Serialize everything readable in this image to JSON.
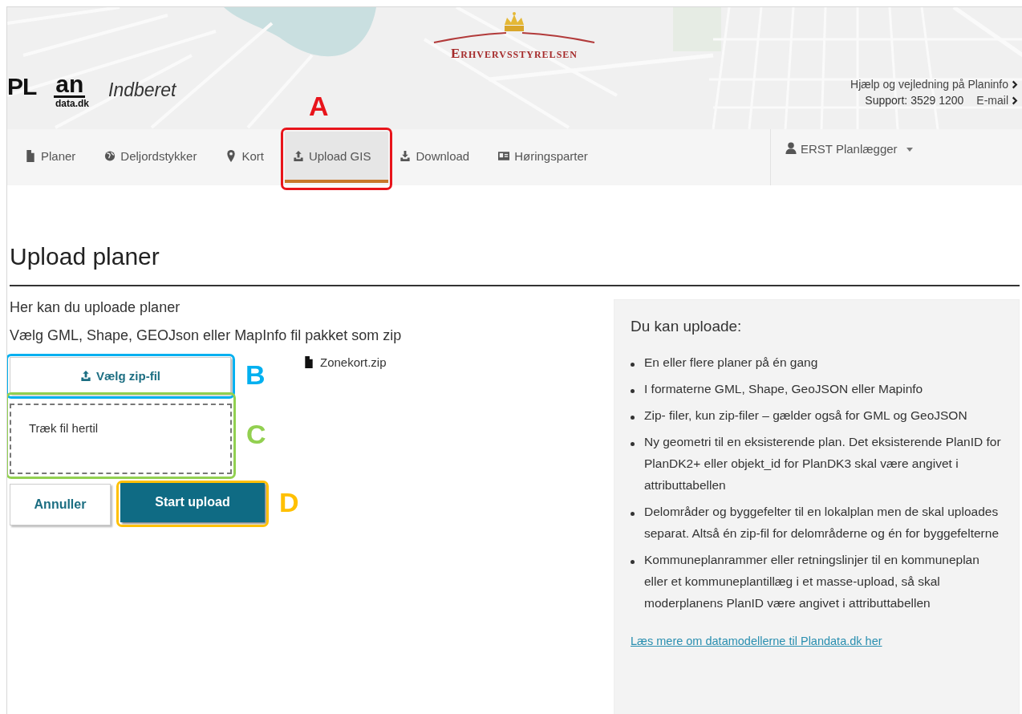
{
  "header": {
    "agency": "Erhvervsstyrelsen",
    "logo_top": "PL",
    "logo_right": "an",
    "logo_sub": "data.dk",
    "app_name": "Indberet",
    "help_link": "Hjælp og vejledning på Planinfo",
    "support": "Support: 3529 1200",
    "email_link": "E-mail"
  },
  "nav": {
    "items": [
      {
        "label": "Planer",
        "selected": false
      },
      {
        "label": "Deljordstykker",
        "selected": false
      },
      {
        "label": "Kort",
        "selected": false
      },
      {
        "label": "Upload GIS",
        "selected": true,
        "callout": {
          "label": "A",
          "color": "#e8141b"
        }
      },
      {
        "label": "Download",
        "selected": false
      },
      {
        "label": "Høringsparter",
        "selected": false
      }
    ],
    "user": "ERST Planlægger"
  },
  "page_title": "Upload planer",
  "intro": [
    "Her kan du uploade planer",
    "Vælg GML, Shape, GEOJson eller MapInfo fil pakket som zip"
  ],
  "choose_button": {
    "label": "Vælg zip-fil",
    "callout": {
      "label": "B",
      "color": "#00b0f0"
    }
  },
  "selected_file": "Zonekort.zip",
  "drop_zone": {
    "text": "Træk fil hertil",
    "callout": {
      "label": "C",
      "color": "#92d050"
    }
  },
  "cancel_button": "Annuller",
  "start_button": {
    "label": "Start upload",
    "callout": {
      "label": "D",
      "color": "#ffc000"
    }
  },
  "info_panel": {
    "title": "Du kan uploade:",
    "items": [
      "En eller flere planer på én gang",
      "I formaterne GML, Shape, GeoJSON eller Mapinfo",
      "Zip- filer, kun zip-filer – gælder også for GML og GeoJSON",
      "Ny geometri til en eksisterende plan. Det eksisterende PlanID for PlanDK2+ eller objekt_id for PlanDK3 skal være angivet i attributtabellen",
      "Delområder og byggefelter til en lokalplan men de skal uploades separat. Altså én zip-fil for delområderne og én for byggefelterne",
      "Kommuneplanrammer eller retningslinjer til en kommuneplan eller et kommuneplantillæg i et masse-upload, så skal moderplanens PlanID være angivet i attributtabellen"
    ],
    "link": "Læs mere om datamodellerne til Plandata.dk her"
  }
}
